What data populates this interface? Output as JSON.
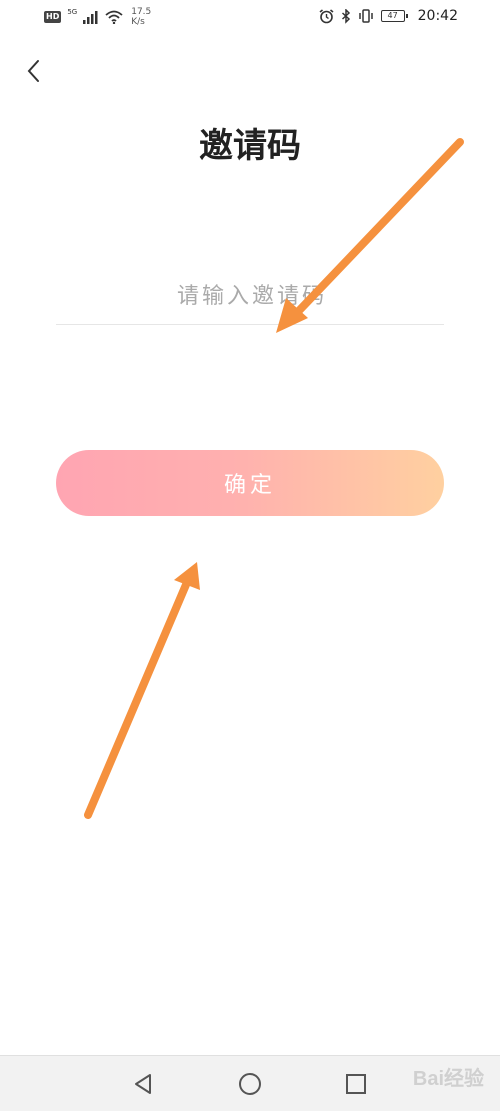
{
  "status_bar": {
    "hd_badge": "HD",
    "network": "5G",
    "speed_value": "17.5",
    "speed_unit": "K/s",
    "battery": "47",
    "time": "20:42"
  },
  "page": {
    "title": "邀请码",
    "input_placeholder": "请输入邀请码",
    "input_value": "",
    "confirm_label": "确定"
  },
  "watermark": {
    "text": "Bai经验"
  },
  "colors": {
    "button_gradient_start": "#ffa5b2",
    "button_gradient_end": "#ffd0a0",
    "annotation_arrow": "#f5913e"
  }
}
